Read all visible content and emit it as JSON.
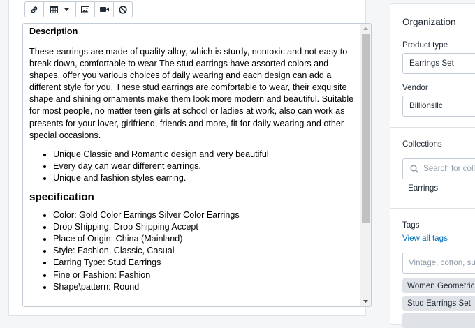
{
  "toolbar": {
    "buttons": [
      {
        "icon": "link-icon"
      },
      {
        "icon": "table-icon"
      },
      {
        "icon": "image-icon"
      },
      {
        "icon": "video-icon"
      },
      {
        "icon": "clear-format-icon"
      }
    ]
  },
  "editor": {
    "description_title": "Description",
    "description_text": "These earrings are made of quality alloy, which is sturdy, nontoxic and not easy to break down, comfortable to wear The stud earrings have assorted colors and shapes, offer you various choices of daily wearing and each design can add a different style for you. These stud earrings are comfortable to wear, their exquisite shape and shining ornaments make them look more modern and beautiful. Suitable for most people, no matter teen girls at school or ladies at work, also can work as presents for your lover, girlfriend, friends and more, fit for daily wearing and other special occasions.",
    "features": [
      "Unique Classic and Romantic design and very beautiful",
      "Every day can wear different earrings.",
      "Unique and fashion styles earring."
    ],
    "spec_title": "specification",
    "spec_items": [
      "Color: Gold Color Earrings Silver Color Earrings",
      "Drop Shipping: Drop Shipping Accept",
      "Place of Origin: China (Mainland)",
      "Style: Fashion, Classic, Casual",
      "Earring Type: Stud Earrings",
      "Fine or Fashion: Fashion",
      "Shape\\pattern: Round"
    ]
  },
  "organization": {
    "title": "Organization",
    "product_type_label": "Product type",
    "product_type_value": "Earrings Set",
    "vendor_label": "Vendor",
    "vendor_value": "Billionsllc",
    "collections_label": "Collections",
    "collections_search_placeholder": "Search for coll",
    "collections": [
      "Earrings"
    ],
    "tags_label": "Tags",
    "view_all_tags": "View all tags",
    "tags_placeholder": "Vintage, cotton, su",
    "tags": [
      "Women Geometric",
      "Stud Earrings Set",
      ""
    ]
  },
  "colors": {
    "link": "#006fbb",
    "border": "#c4cdd5",
    "panel_bg": "#f4f6f8",
    "chip_bg": "#dfe3e8"
  }
}
